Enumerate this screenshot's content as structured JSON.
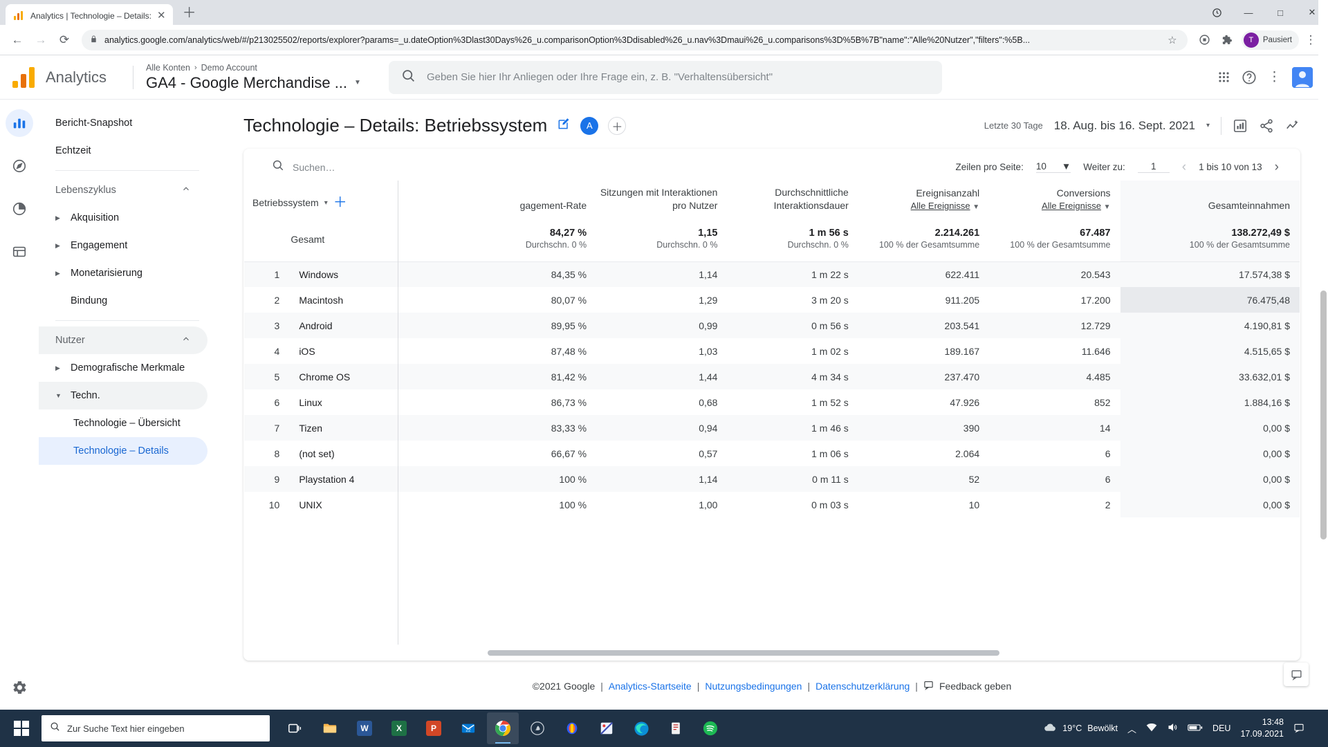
{
  "browser": {
    "tab_title": "Analytics | Technologie – Details:",
    "tab_close": "✕",
    "new_tab": "＋",
    "url": "analytics.google.com/analytics/web/#/p213025502/reports/explorer?params=_u.dateOption%3Dlast30Days%26_u.comparisonOption%3Ddisabled%26_u.nav%3Dmaui%26_u.comparisons%3D%5B%7B\"name\":\"Alle%20Nutzer\",\"filters\":%5B...",
    "back": "←",
    "forward": "→",
    "reload": "⟳",
    "lock": "🔒",
    "star": "☆",
    "minimize": "—",
    "maximize": "□",
    "close": "✕",
    "extension_label": "•",
    "profile_initial": "T",
    "profile_label": "Pausiert"
  },
  "ga_header": {
    "wordmark": "Analytics",
    "breadcrumb_root": "Alle Konten",
    "breadcrumb_sep": "›",
    "breadcrumb_account": "Demo Account",
    "property": "GA4 - Google Merchandise ...",
    "search_placeholder": "Geben Sie hier Ihr Anliegen oder Ihre Frage ein, z. B. \"Verhaltensübersicht\""
  },
  "sidebar": {
    "items": [
      {
        "label": "Bericht-Snapshot",
        "type": "item",
        "indent": false
      },
      {
        "label": "Echtzeit",
        "type": "item",
        "indent": false
      },
      {
        "label": "Lebenszyklus",
        "type": "section",
        "collapsed": false
      },
      {
        "label": "Akquisition",
        "type": "expandable"
      },
      {
        "label": "Engagement",
        "type": "expandable"
      },
      {
        "label": "Monetarisierung",
        "type": "expandable"
      },
      {
        "label": "Bindung",
        "type": "item",
        "indent": true
      },
      {
        "label": "Nutzer",
        "type": "section",
        "collapsed": false
      },
      {
        "label": "Demografische Merkmale",
        "type": "expandable"
      },
      {
        "label": "Techn.",
        "type": "expandable-open"
      },
      {
        "label": "Technologie – Übersicht",
        "type": "sub"
      },
      {
        "label": "Technologie – Details",
        "type": "sub-selected"
      }
    ],
    "collapse_icon": "‹"
  },
  "page": {
    "title": "Technologie – Details: Betriebssystem",
    "edit_icon": "✎",
    "badge_a": "A",
    "add_comparison": "＋",
    "range_label": "Letzte 30 Tage",
    "range_value": "18. Aug. bis 16. Sept. 2021",
    "range_caret": "▾"
  },
  "toolbar": {
    "search_placeholder": "Suchen…",
    "rows_per_page_label": "Zeilen pro Seite:",
    "rows_per_page_value": "10",
    "goto_label": "Weiter zu:",
    "goto_value": "1",
    "range_text": "1 bis 10 von 13",
    "prev": "‹",
    "next": "›"
  },
  "table": {
    "dimension_header": "Betriebssystem",
    "dimension_caret": "▾",
    "add_dimension": "＋",
    "columns": [
      {
        "title": "gagement-Rate",
        "sub": ""
      },
      {
        "title": "Sitzungen mit Interaktionen pro Nutzer",
        "sub": ""
      },
      {
        "title": "Durchschnittliche Interaktionsdauer",
        "sub": ""
      },
      {
        "title": "Ereignisanzahl",
        "sub": "Alle Ereignisse"
      },
      {
        "title": "Conversions",
        "sub": "Alle Ereignisse"
      },
      {
        "title": "Gesamteinnahmen",
        "sub": ""
      }
    ],
    "total_row": {
      "label": "Gesamt",
      "values": [
        "84,27 %",
        "1,15",
        "1 m 56 s",
        "2.214.261",
        "67.487",
        "138.272,49 $"
      ],
      "subs": [
        "Durchschn. 0 %",
        "Durchschn. 0 %",
        "Durchschn. 0 %",
        "100 % der Gesamtsumme",
        "100 % der Gesamtsumme",
        "100 % der Gesamtsumme"
      ]
    },
    "rows": [
      {
        "idx": "1",
        "dim": "Windows",
        "v": [
          "84,35 %",
          "1,14",
          "1 m 22 s",
          "622.411",
          "20.543",
          "17.574,38 $"
        ]
      },
      {
        "idx": "2",
        "dim": "Macintosh",
        "v": [
          "80,07 %",
          "1,29",
          "3 m 20 s",
          "911.205",
          "17.200",
          "76.475,48"
        ]
      },
      {
        "idx": "3",
        "dim": "Android",
        "v": [
          "89,95 %",
          "0,99",
          "0 m 56 s",
          "203.541",
          "12.729",
          "4.190,81 $"
        ]
      },
      {
        "idx": "4",
        "dim": "iOS",
        "v": [
          "87,48 %",
          "1,03",
          "1 m 02 s",
          "189.167",
          "11.646",
          "4.515,65 $"
        ]
      },
      {
        "idx": "5",
        "dim": "Chrome OS",
        "v": [
          "81,42 %",
          "1,44",
          "4 m 34 s",
          "237.470",
          "4.485",
          "33.632,01 $"
        ]
      },
      {
        "idx": "6",
        "dim": "Linux",
        "v": [
          "86,73 %",
          "0,68",
          "1 m 52 s",
          "47.926",
          "852",
          "1.884,16 $"
        ]
      },
      {
        "idx": "7",
        "dim": "Tizen",
        "v": [
          "83,33 %",
          "0,94",
          "1 m 46 s",
          "390",
          "14",
          "0,00 $"
        ]
      },
      {
        "idx": "8",
        "dim": "(not set)",
        "v": [
          "66,67 %",
          "0,57",
          "1 m 06 s",
          "2.064",
          "6",
          "0,00 $"
        ]
      },
      {
        "idx": "9",
        "dim": "Playstation 4",
        "v": [
          "100 %",
          "1,14",
          "0 m 11 s",
          "52",
          "6",
          "0,00 $"
        ]
      },
      {
        "idx": "10",
        "dim": "UNIX",
        "v": [
          "100 %",
          "1,00",
          "0 m 03 s",
          "10",
          "2",
          "0,00 $"
        ]
      }
    ],
    "hovered_row_index": 1
  },
  "footer": {
    "copyright": "©2021 Google",
    "bar": "|",
    "link_home": "Analytics-Startseite",
    "link_terms": "Nutzungsbedingungen",
    "link_privacy": "Datenschutzerklärung",
    "feedback": "Feedback geben"
  },
  "taskbar": {
    "search_text": "Zur Suche Text hier eingeben",
    "weather_temp": "19°C",
    "weather_desc": "Bewölkt",
    "language": "DEU",
    "time": "13:48",
    "date": "17.09.2021",
    "apps": [
      "task-view",
      "file-explorer",
      "word",
      "excel",
      "powerpoint",
      "mail",
      "chrome",
      "discord",
      "audacity",
      "paint-net",
      "edge",
      "reader",
      "spotify"
    ]
  },
  "colors": {
    "accent": "#1a73e8",
    "highlight": "#e8f0fe",
    "ga_orange": "#e8710a",
    "ga_yellow": "#f9ab00",
    "taskbar": "#1f3246"
  }
}
